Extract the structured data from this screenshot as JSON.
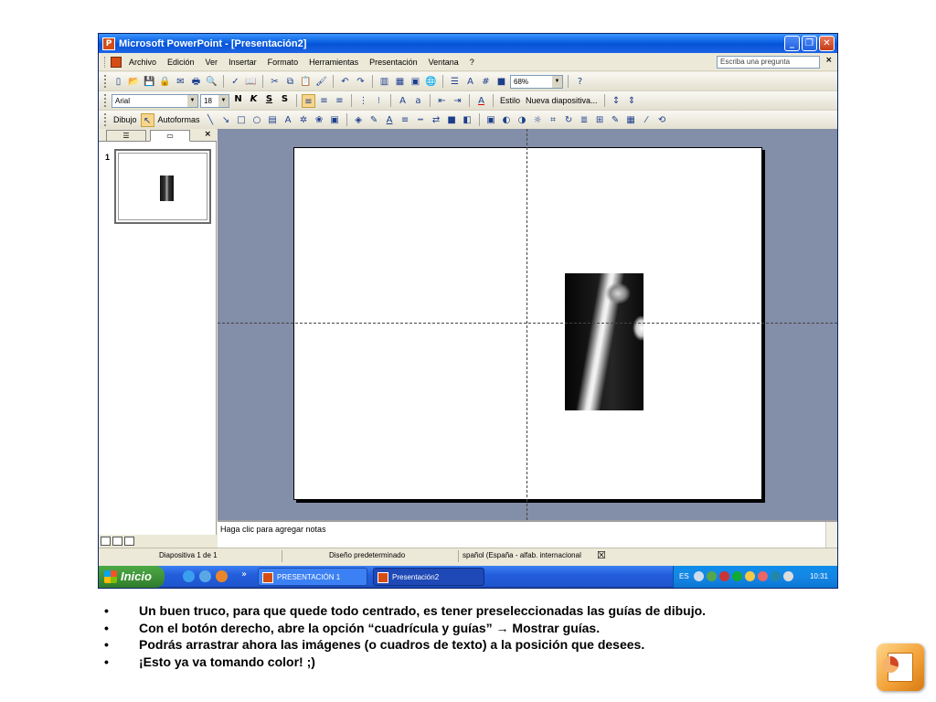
{
  "window": {
    "title": "Microsoft PowerPoint - [Presentación2]",
    "app_icon": "P",
    "buttons": {
      "minimize": "_",
      "maximize": "❐",
      "close": "✕"
    }
  },
  "menu": {
    "items": [
      "Archivo",
      "Edición",
      "Ver",
      "Insertar",
      "Formato",
      "Herramientas",
      "Presentación",
      "Ventana",
      "?"
    ],
    "ask_placeholder": "Escriba una pregunta",
    "close": "×"
  },
  "toolbar_standard": {
    "zoom": "68%"
  },
  "toolbar_format": {
    "font": "Arial",
    "size": "18",
    "bold": "N",
    "italic": "K",
    "underline": "S",
    "shadow": "S",
    "design_label": "Estilo",
    "new_slide_label": "Nueva diapositiva..."
  },
  "toolbar_drawing": {
    "draw_label": "Dibujo",
    "autoshapes_label": "Autoformas"
  },
  "slides_pane": {
    "slide_number": "1",
    "close": "×"
  },
  "notes": {
    "placeholder": "Haga clic para agregar notas"
  },
  "status": {
    "slide": "Diapositiva 1 de 1",
    "design": "Diseño predeterminado",
    "language": "spañol (España - alfab. internacional"
  },
  "taskbar": {
    "start": "Inicio",
    "chevron": "»",
    "tasks": [
      "PRESENTACIÓN 1",
      "Presentación2"
    ],
    "lang": "ES",
    "clock": "10:31"
  },
  "bullets": [
    "Un  buen truco, para que quede todo centrado, es tener preseleccionadas las guías de dibujo.",
    "Con el botón derecho, abre la opción “cuadrícula y guías” → Mostrar guías.",
    "Podrás arrastrar ahora las imágenes (o cuadros de texto) a la posición que desees.",
    "¡Esto ya va tomando color! ;)"
  ],
  "colors": {
    "titlebar": "#0a5fe0",
    "edit_area": "#838ea8",
    "taskbar": "#245edc",
    "start_button": "#3c8f36",
    "logo_orange": "#f3a33a"
  }
}
